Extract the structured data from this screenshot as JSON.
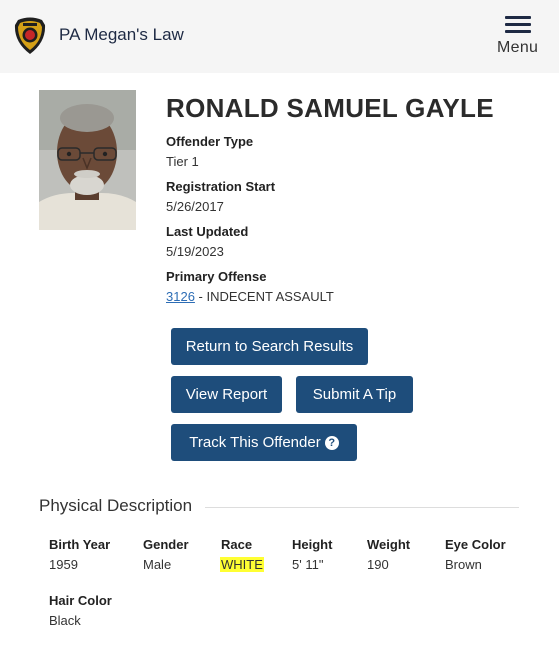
{
  "header": {
    "brand": "PA Megan's Law",
    "menu_label": "Menu"
  },
  "offender": {
    "name": "RONALD SAMUEL GAYLE",
    "fields": {
      "offender_type": {
        "label": "Offender Type",
        "value": "Tier 1"
      },
      "registration_start": {
        "label": "Registration Start",
        "value": "5/26/2017"
      },
      "last_updated": {
        "label": "Last Updated",
        "value": "5/19/2023"
      },
      "primary_offense": {
        "label": "Primary Offense",
        "code": "3126",
        "description": " - INDECENT ASSAULT"
      }
    }
  },
  "actions": {
    "return_label": "Return to Search Results",
    "view_report_label": "View Report",
    "submit_tip_label": "Submit A Tip",
    "track_label": "Track This Offender",
    "track_help": "?"
  },
  "physical": {
    "title": "Physical Description",
    "birth_year": {
      "label": "Birth Year",
      "value": "1959"
    },
    "gender": {
      "label": "Gender",
      "value": "Male"
    },
    "race": {
      "label": "Race",
      "value": "WHITE"
    },
    "height": {
      "label": "Height",
      "value": "5' 11\""
    },
    "weight": {
      "label": "Weight",
      "value": "190"
    },
    "eye_color": {
      "label": "Eye Color",
      "value": "Brown"
    },
    "hair_color": {
      "label": "Hair Color",
      "value": "Black"
    }
  },
  "colors": {
    "button": "#1e4d7b",
    "link": "#2d6db5",
    "highlight": "#ffff33",
    "header_bg": "#f5f5f5"
  },
  "icons": {
    "logo": "state-police-badge-icon",
    "menu": "hamburger-menu-icon"
  }
}
